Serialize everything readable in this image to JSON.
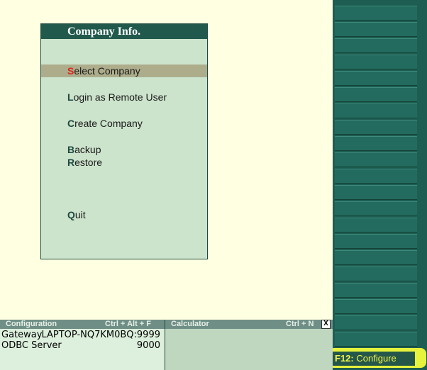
{
  "panel": {
    "title": "Company Info.",
    "items": [
      {
        "hotkey": "S",
        "rest": "elect Company",
        "selected": true
      },
      {
        "hotkey": "L",
        "rest": "ogin as Remote User"
      },
      {
        "hotkey": "C",
        "rest": "reate Company"
      },
      {
        "hotkey": "B",
        "rest": "ackup"
      },
      {
        "hotkey": "R",
        "rest": "estore"
      },
      {
        "hotkey": "Q",
        "rest": "uit"
      }
    ]
  },
  "config": {
    "title": "Configuration",
    "shortcut": "Ctrl + Alt + F",
    "rows": [
      {
        "label": "Gateway",
        "value": "LAPTOP-NQ7KM0BQ:9999"
      },
      {
        "label": "ODBC Server",
        "value": "9000"
      }
    ]
  },
  "calculator": {
    "title": "Calculator",
    "shortcut": "Ctrl + N",
    "close": "X"
  },
  "right_bar": {
    "f12_key": "F12:",
    "f12_label": "Configure"
  },
  "colors": {
    "background": "#FFFFE1",
    "panel": "#CCE3CC",
    "title_bar": "#215A4C",
    "selection": "#ADAD8C",
    "hotkey_selected": "#E0241B",
    "button_bar": "#1E5E52",
    "highlight": "#E6F23C"
  }
}
